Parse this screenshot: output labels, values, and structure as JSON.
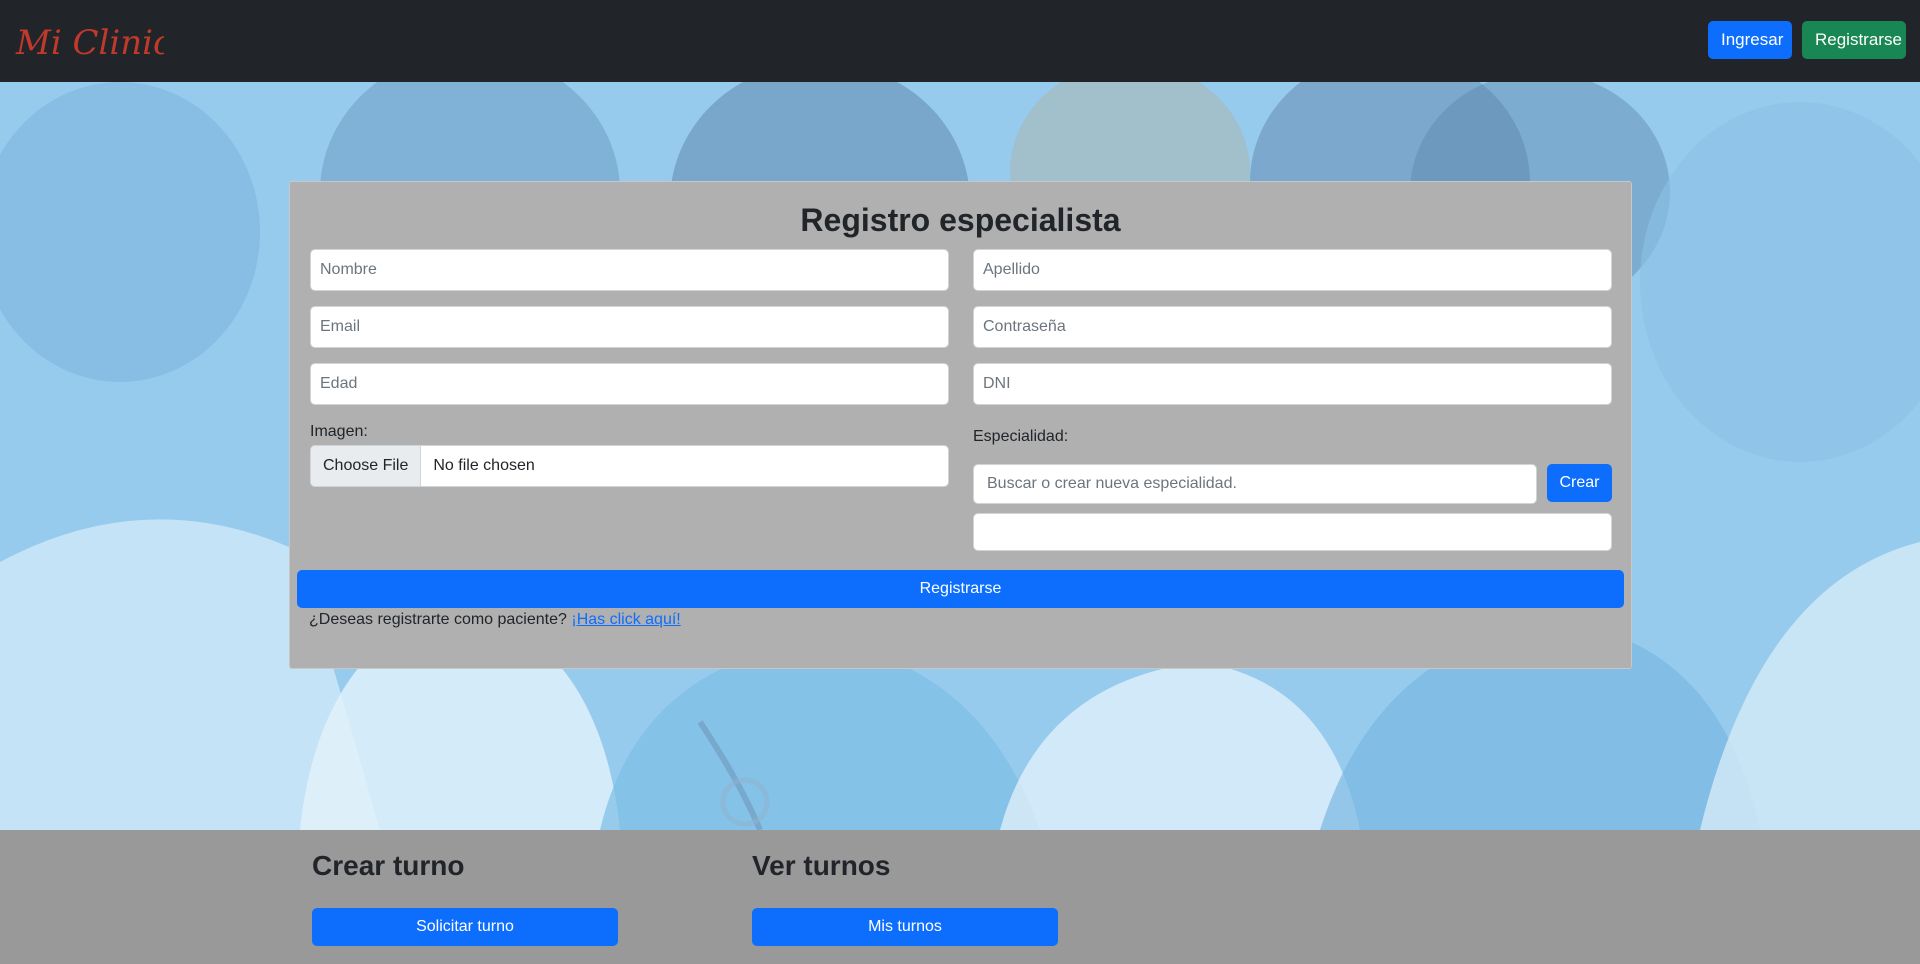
{
  "navbar": {
    "brand": "Mi Clinica",
    "login_label": "Ingresar",
    "register_label": "Registrarse"
  },
  "form": {
    "title": "Registro especialista",
    "nombre_placeholder": "Nombre",
    "apellido_placeholder": "Apellido",
    "email_placeholder": "Email",
    "password_placeholder": "Contraseña",
    "edad_placeholder": "Edad",
    "dni_placeholder": "DNI",
    "imagen_label": "Imagen:",
    "choose_file_label": "Choose File",
    "no_file_label": "No file chosen",
    "especialidad_label": "Especialidad:",
    "especialidad_search_placeholder": "Buscar o crear nueva especialidad.",
    "crear_label": "Crear",
    "especialidad_value": "",
    "submit_label": "Registrarse",
    "patient_question": "¿Deseas registrarte como paciente?",
    "patient_link": "¡Has click aquí!"
  },
  "bottom": {
    "crear_turno_title": "Crear turno",
    "solicitar_turno_label": "Solicitar turno",
    "ver_turnos_title": "Ver turnos",
    "mis_turnos_label": "Mis turnos"
  },
  "colors": {
    "navbar_bg": "#212529",
    "primary": "#0d6efd",
    "success": "#198754",
    "brand_script": "#c0392b",
    "card_bg": "#b0b0b0"
  }
}
